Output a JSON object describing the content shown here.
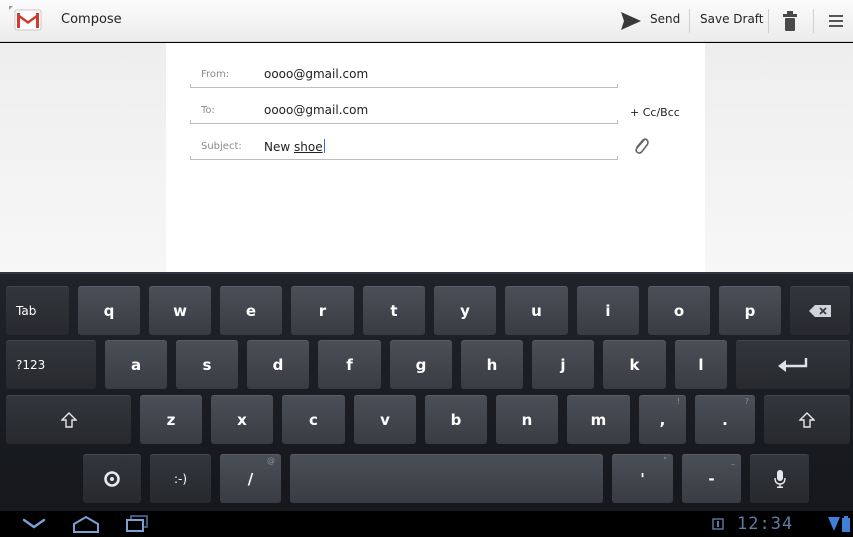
{
  "actionbar": {
    "title": "Compose",
    "send_label": "Send",
    "save_draft_label": "Save Draft",
    "app_icon": "gmail-icon",
    "send_icon": "send-icon",
    "trash_icon": "trash-icon",
    "overflow_icon": "overflow-menu-icon"
  },
  "compose": {
    "from": {
      "label": "From:",
      "value": "oooo@gmail.com"
    },
    "to": {
      "label": "To:",
      "value": "oooo@gmail.com"
    },
    "subject": {
      "label": "Subject:",
      "prefix": "New ",
      "typed": "shoe"
    },
    "cc_bcc_label": "+ Cc/Bcc",
    "attach_icon": "paperclip-icon"
  },
  "keyboard": {
    "row1": [
      "Tab",
      "q",
      "w",
      "e",
      "r",
      "t",
      "y",
      "u",
      "i",
      "o",
      "p"
    ],
    "row2": [
      "?123",
      "a",
      "s",
      "d",
      "f",
      "g",
      "h",
      "j",
      "k",
      "l"
    ],
    "row3": [
      "z",
      "x",
      "c",
      "v",
      "b",
      "n",
      "m",
      ",",
      "."
    ],
    "row3_hints": [
      "!",
      "?"
    ],
    "row4": [
      ":-)",
      "/",
      "'",
      "-"
    ],
    "row4_hints": [
      "@",
      "\"",
      "_"
    ],
    "icons": [
      "backspace-icon",
      "enter-icon",
      "shift-icon",
      "settings-icon",
      "mic-icon"
    ]
  },
  "status": {
    "time": "12:34",
    "icons": [
      "back-icon",
      "home-icon",
      "recent-apps-icon",
      "notification-icon",
      "wifi-icon",
      "battery-icon"
    ]
  },
  "colors": {
    "accent": "#2a6fd6",
    "keyboard_bg": "#1b1d22",
    "key": "#43474f",
    "clock": "#5e7ba3"
  }
}
